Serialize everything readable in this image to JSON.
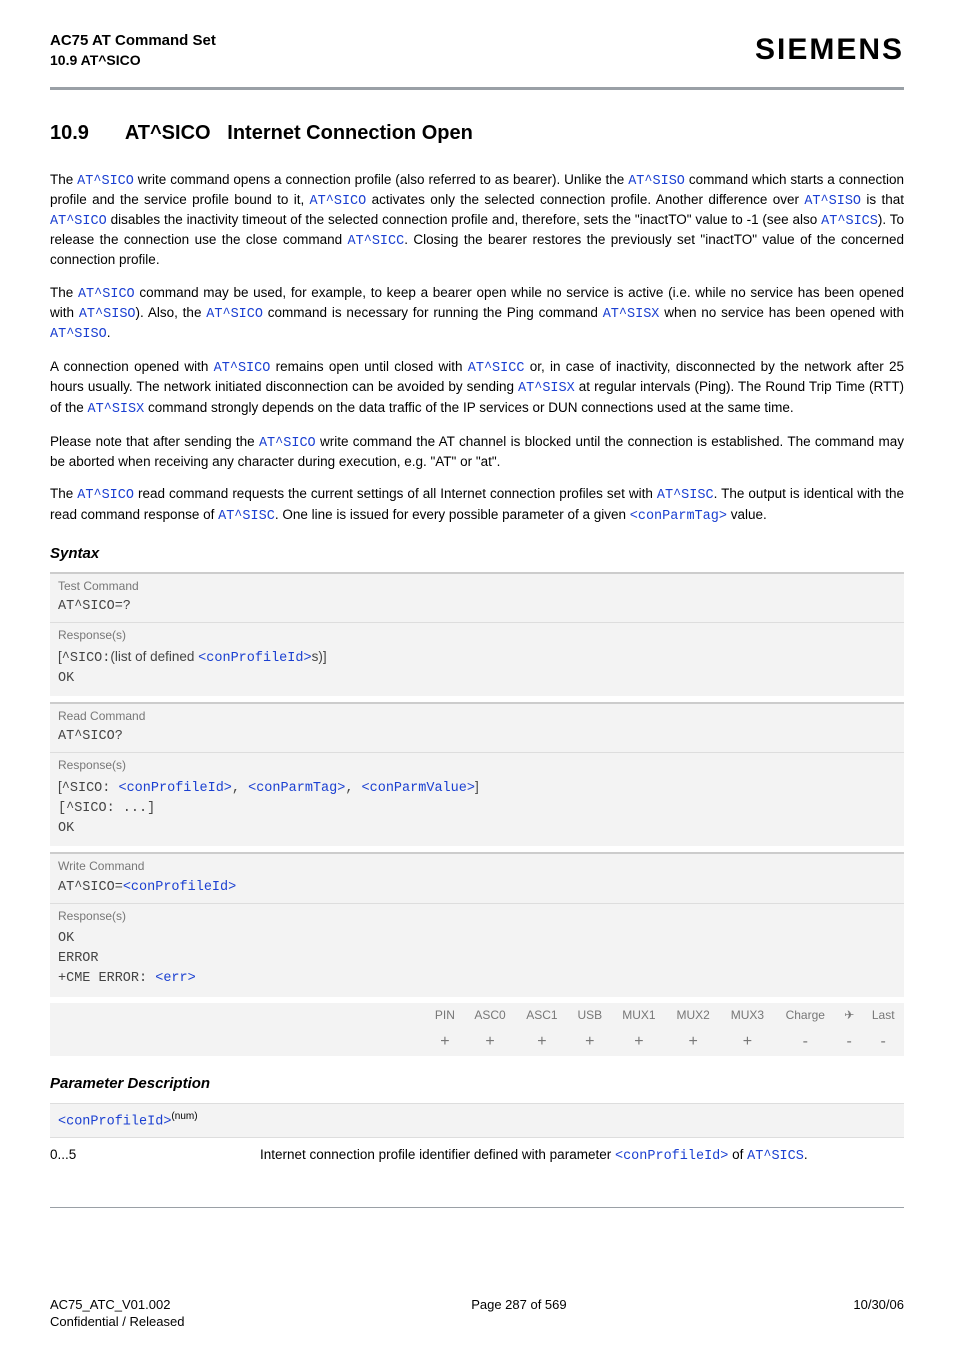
{
  "header": {
    "line1": "AC75 AT Command Set",
    "line2": "10.9 AT^SICO",
    "brand": "SIEMENS"
  },
  "title": {
    "num": "10.9",
    "cmd": "AT^SICO",
    "name": "Internet Connection Open"
  },
  "paras": {
    "p1_a": "The ",
    "p1_cmd1": "AT^SICO",
    "p1_b": " write command opens a connection profile (also referred to as bearer). Unlike the ",
    "p1_cmd2": "AT^SISO",
    "p1_c": " command which starts a connection profile and the service profile bound to it, ",
    "p1_cmd3": "AT^SICO",
    "p1_d": " activates only the selected connection profile. Another difference over ",
    "p1_cmd4": "AT^SISO",
    "p1_e": " is that ",
    "p1_cmd5": "AT^SICO",
    "p1_f": " disables the inactivity timeout of the selected connection profile and, therefore, sets the \"inactTO\" value to -1 (see also ",
    "p1_cmd6": "AT^SICS",
    "p1_g": "). To release the connection use the close command ",
    "p1_cmd7": "AT^SICC",
    "p1_h": ". Closing the bearer restores the previously set \"inactTO\" value of the concerned connection profile.",
    "p2_a": "The ",
    "p2_cmd1": "AT^SICO",
    "p2_b": " command may be used, for example, to keep a bearer open while no service is active (i.e. while no service has been opened with ",
    "p2_cmd2": "AT^SISO",
    "p2_c": "). Also, the ",
    "p2_cmd3": "AT^SICO",
    "p2_d": " command is necessary for running the Ping command ",
    "p2_cmd4": "AT^SISX",
    "p2_e": " when no service has been opened with ",
    "p2_cmd5": "AT^SISO",
    "p2_f": ".",
    "p3_a": "A connection opened with ",
    "p3_cmd1": "AT^SICO",
    "p3_b": " remains open until closed with ",
    "p3_cmd2": "AT^SICC",
    "p3_c": " or, in case of inactivity, disconnected by the network after 25 hours usually. The network initiated disconnection can be avoided by sending ",
    "p3_cmd3": "AT^SISX",
    "p3_d": " at regular intervals (Ping). The Round Trip Time (RTT) of the ",
    "p3_cmd4": "AT^SISX",
    "p3_e": " command strongly depends on the data traffic of the IP services or DUN connections used at the same time.",
    "p4_a": "Please note that after sending the ",
    "p4_cmd1": "AT^SICO",
    "p4_b": " write command the AT channel is blocked until the connection is established. The command may be aborted when receiving any character during execution, e.g. \"AT\" or \"at\".",
    "p5_a": "The ",
    "p5_cmd1": "AT^SICO",
    "p5_b": " read command requests the current settings of all Internet connection profiles set with ",
    "p5_cmd2": "AT^SISC",
    "p5_c": ". The output is identical with the read command response of ",
    "p5_cmd3": "AT^SISC",
    "p5_d": ". One line is issued for every possible parameter of a given ",
    "p5_param": "<conParmTag>",
    "p5_e": " value."
  },
  "syntaxHeading": "Syntax",
  "syntax": {
    "test": {
      "label": "Test Command",
      "cmd": "AT^SICO=?",
      "respLabel": "Response(s)",
      "resp_a": "[",
      "resp_b": "^SICO:",
      "resp_c": "(list of defined ",
      "resp_param": "<conProfileId>",
      "resp_d": "s)]",
      "ok": "OK"
    },
    "read": {
      "label": "Read Command",
      "cmd": "AT^SICO?",
      "respLabel": "Response(s)",
      "resp_a": "[",
      "resp_b": "^SICO: ",
      "resp_p1": "<conProfileId>",
      "resp_sep1": ", ",
      "resp_p2": "<conParmTag>",
      "resp_sep2": ", ",
      "resp_p3": "<conParmValue>",
      "resp_c": "]",
      "line2": "[^SICO: ...]",
      "ok": "OK"
    },
    "write": {
      "label": "Write Command",
      "cmd_a": "AT^SICO=",
      "cmd_p": "<conProfileId>",
      "respLabel": "Response(s)",
      "ok": "OK",
      "err": "ERROR",
      "cme_a": "+CME ERROR: ",
      "cme_p": "<err>"
    }
  },
  "ifaceTable": {
    "headers": [
      "PIN",
      "ASC0",
      "ASC1",
      "USB",
      "MUX1",
      "MUX2",
      "MUX3",
      "Charge",
      "✈",
      "Last"
    ],
    "values": [
      "+",
      "+",
      "+",
      "+",
      "+",
      "+",
      "+",
      "-",
      "-",
      "-"
    ]
  },
  "paramHeading": "Parameter Description",
  "param": {
    "name": "<conProfileId>",
    "sup": "(num)",
    "range": "0...5",
    "desc_a": "Internet connection profile identifier defined with parameter ",
    "desc_p": "<conProfileId>",
    "desc_b": " of ",
    "desc_cmd": "AT^SICS",
    "desc_c": "."
  },
  "footer": {
    "left1": "AC75_ATC_V01.002",
    "left2": "Confidential / Released",
    "center": "Page 287 of 569",
    "right": "10/30/06"
  }
}
